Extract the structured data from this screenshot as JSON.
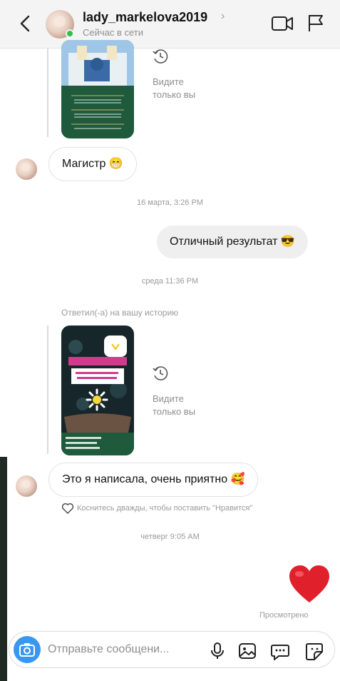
{
  "header": {
    "username": "lady_markelova2019",
    "status": "Сейчас в сети",
    "chevron": "›"
  },
  "stories": [
    {
      "seen_text": "Видите\nтолько вы",
      "colors": {
        "sky": "#9fc6e6",
        "building": "#e8f0f4",
        "panel": "#1e5a3b"
      }
    },
    {
      "seen_text": "Видите\nтолько вы",
      "colors": {
        "bg": "#17262a",
        "pink": "#d23a8c",
        "panel": "#1e5a3b"
      }
    }
  ],
  "messages": [
    {
      "text": "Магистр 😁"
    },
    {
      "text": "Отличный результат 😎"
    },
    {
      "text": "Это я написала, очень приятно 🥰"
    }
  ],
  "timestamps": {
    "t1": "16 марта, 3:26 PM",
    "t2": "среда 11:36 PM",
    "t3": "четверг 9:05 AM"
  },
  "replied_to_story": "Ответил(-а) на вашу историю",
  "like_hint": "Коснитесь дважды, чтобы поставить \"Нравится\"",
  "seen_status": "Просмотрено",
  "composer": {
    "placeholder": "Отправьте сообщени..."
  },
  "colors": {
    "accent": "#3897f0",
    "online": "#2ec24b",
    "heart": "#e0202a"
  },
  "icons": {
    "back": "chevron-left",
    "video": "video-camera",
    "flag": "flag",
    "seen": "history-clock",
    "camera": "camera",
    "mic": "microphone",
    "gallery": "image",
    "chat": "chat-bubble",
    "sticker": "sticker"
  }
}
